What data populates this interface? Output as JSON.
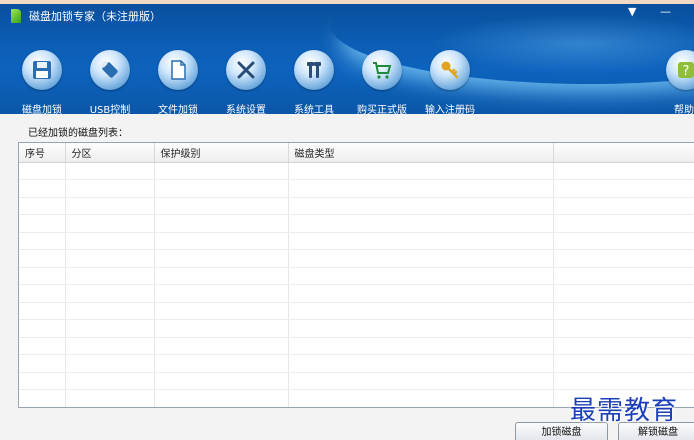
{
  "window": {
    "title": "磁盘加锁专家（未注册版）",
    "menu_glyph": "▼",
    "minimize_glyph": "—"
  },
  "toolbar": {
    "items": [
      {
        "label": "磁盘加锁",
        "icon": "floppy-disk-icon"
      },
      {
        "label": "USB控制",
        "icon": "usb-stick-icon"
      },
      {
        "label": "文件加锁",
        "icon": "file-icon"
      },
      {
        "label": "系统设置",
        "icon": "tools-icon"
      },
      {
        "label": "系统工具",
        "icon": "wrench-icon"
      },
      {
        "label": "购买正式版",
        "icon": "shopping-cart-icon"
      },
      {
        "label": "输入注册码",
        "icon": "key-icon"
      },
      {
        "label": "帮助",
        "icon": "help-icon"
      }
    ]
  },
  "main": {
    "list_caption": "已经加锁的磁盘列表：",
    "columns": [
      "序号",
      "分区",
      "保护级别",
      "磁盘类型",
      ""
    ]
  },
  "buttons": {
    "lock_disk": "加锁磁盘",
    "unlock_disk": "解锁磁盘"
  },
  "watermark": "最需教育",
  "colors": {
    "header_blue": "#0c5db4",
    "watermark_blue": "#1a3fb8"
  }
}
